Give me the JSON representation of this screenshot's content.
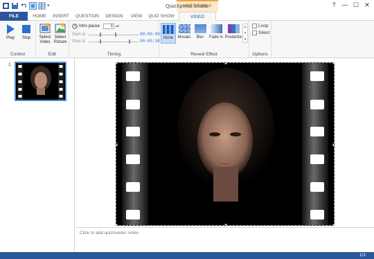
{
  "app": {
    "title": "QuizXpress Studio"
  },
  "contextual": {
    "label": "VIDEO TOOLS"
  },
  "tabs": [
    {
      "label": "FILE"
    },
    {
      "label": "HOME"
    },
    {
      "label": "INSERT"
    },
    {
      "label": "QUESTION"
    },
    {
      "label": "DESIGN"
    },
    {
      "label": "VIEW"
    },
    {
      "label": "QUIZ SHOW"
    },
    {
      "label": "VIDEO"
    }
  ],
  "ribbon": {
    "control": {
      "label": "Control",
      "play": "Play",
      "stop": "Stop"
    },
    "edit": {
      "label": "Edit",
      "select_video_1": "Select",
      "select_video_2": "Video",
      "select_picture_1": "Select",
      "select_picture_2": "Picture"
    },
    "timing": {
      "label": "Timing",
      "intro_pause": "Intro pause",
      "intro_value": "1",
      "start_at": "Start at",
      "stop_at": "Stop at",
      "start_time": "00:00:00",
      "stop_time": "00:00:30"
    },
    "reveal": {
      "label": "Reveal Effect",
      "items": [
        "None",
        "Mosaic",
        "Blur",
        "Fade in",
        "Posterize"
      ],
      "selected": "None"
    },
    "options": {
      "label": "Options",
      "loop": "Loop",
      "silent": "Silent"
    }
  },
  "slides": {
    "number": "1"
  },
  "notes": {
    "placeholder": "Click to add quizmaster notes"
  },
  "status": {
    "page": "1/1"
  },
  "colors": {
    "accent": "#2b579a",
    "context": "#f0a43c",
    "selected": "#c5dcf5"
  }
}
